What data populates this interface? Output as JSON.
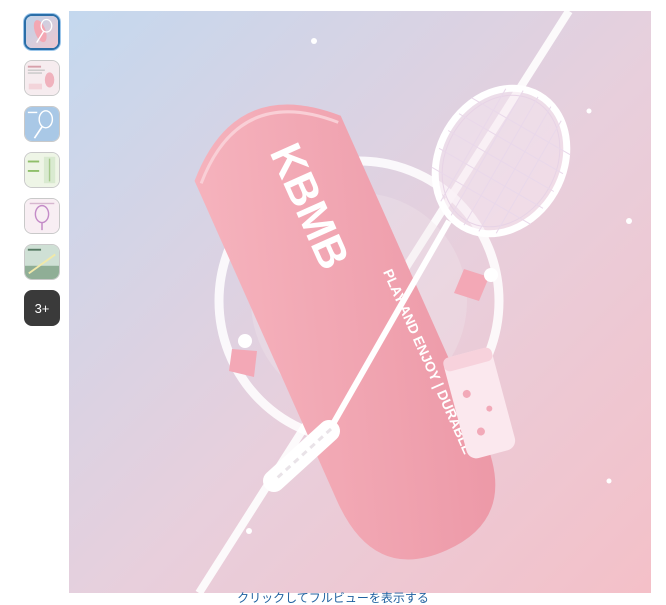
{
  "gallery": {
    "more_count_label": "3+",
    "caption": "クリックしてフルビューを表示する",
    "active_index": 0
  },
  "product_image": {
    "case_brand_text": "KBMB",
    "case_slogan_text": "PLAY AND ENJOY | DURABLE"
  },
  "colors": {
    "accent_border": "#2a6ea8",
    "link": "#2162a1",
    "case_pink": "#f2a1ad",
    "bg_blue": "#c7d9ec",
    "bg_pink": "#f2c3cc"
  }
}
